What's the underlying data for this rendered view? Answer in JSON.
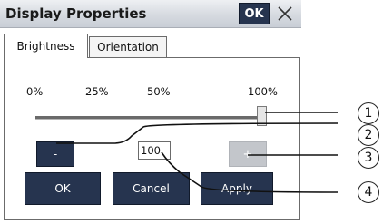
{
  "window": {
    "title": "Display Properties",
    "ok_label": "OK",
    "close_icon": "close-icon"
  },
  "tabs": [
    {
      "label": "Brightness",
      "active": true
    },
    {
      "label": "Orientation",
      "active": false
    }
  ],
  "brightness": {
    "scale_labels": [
      "0%",
      "25%",
      "50%",
      "100%"
    ],
    "slider_level_percent": 100,
    "minus_label": "-",
    "plus_label": "+",
    "value": "100"
  },
  "buttons": {
    "ok": "OK",
    "cancel": "Cancel",
    "apply": "Apply"
  },
  "callouts": [
    "1",
    "2",
    "3",
    "4"
  ],
  "colors": {
    "button_dark": "#26344f",
    "button_disabled": "#c3c6cb"
  }
}
